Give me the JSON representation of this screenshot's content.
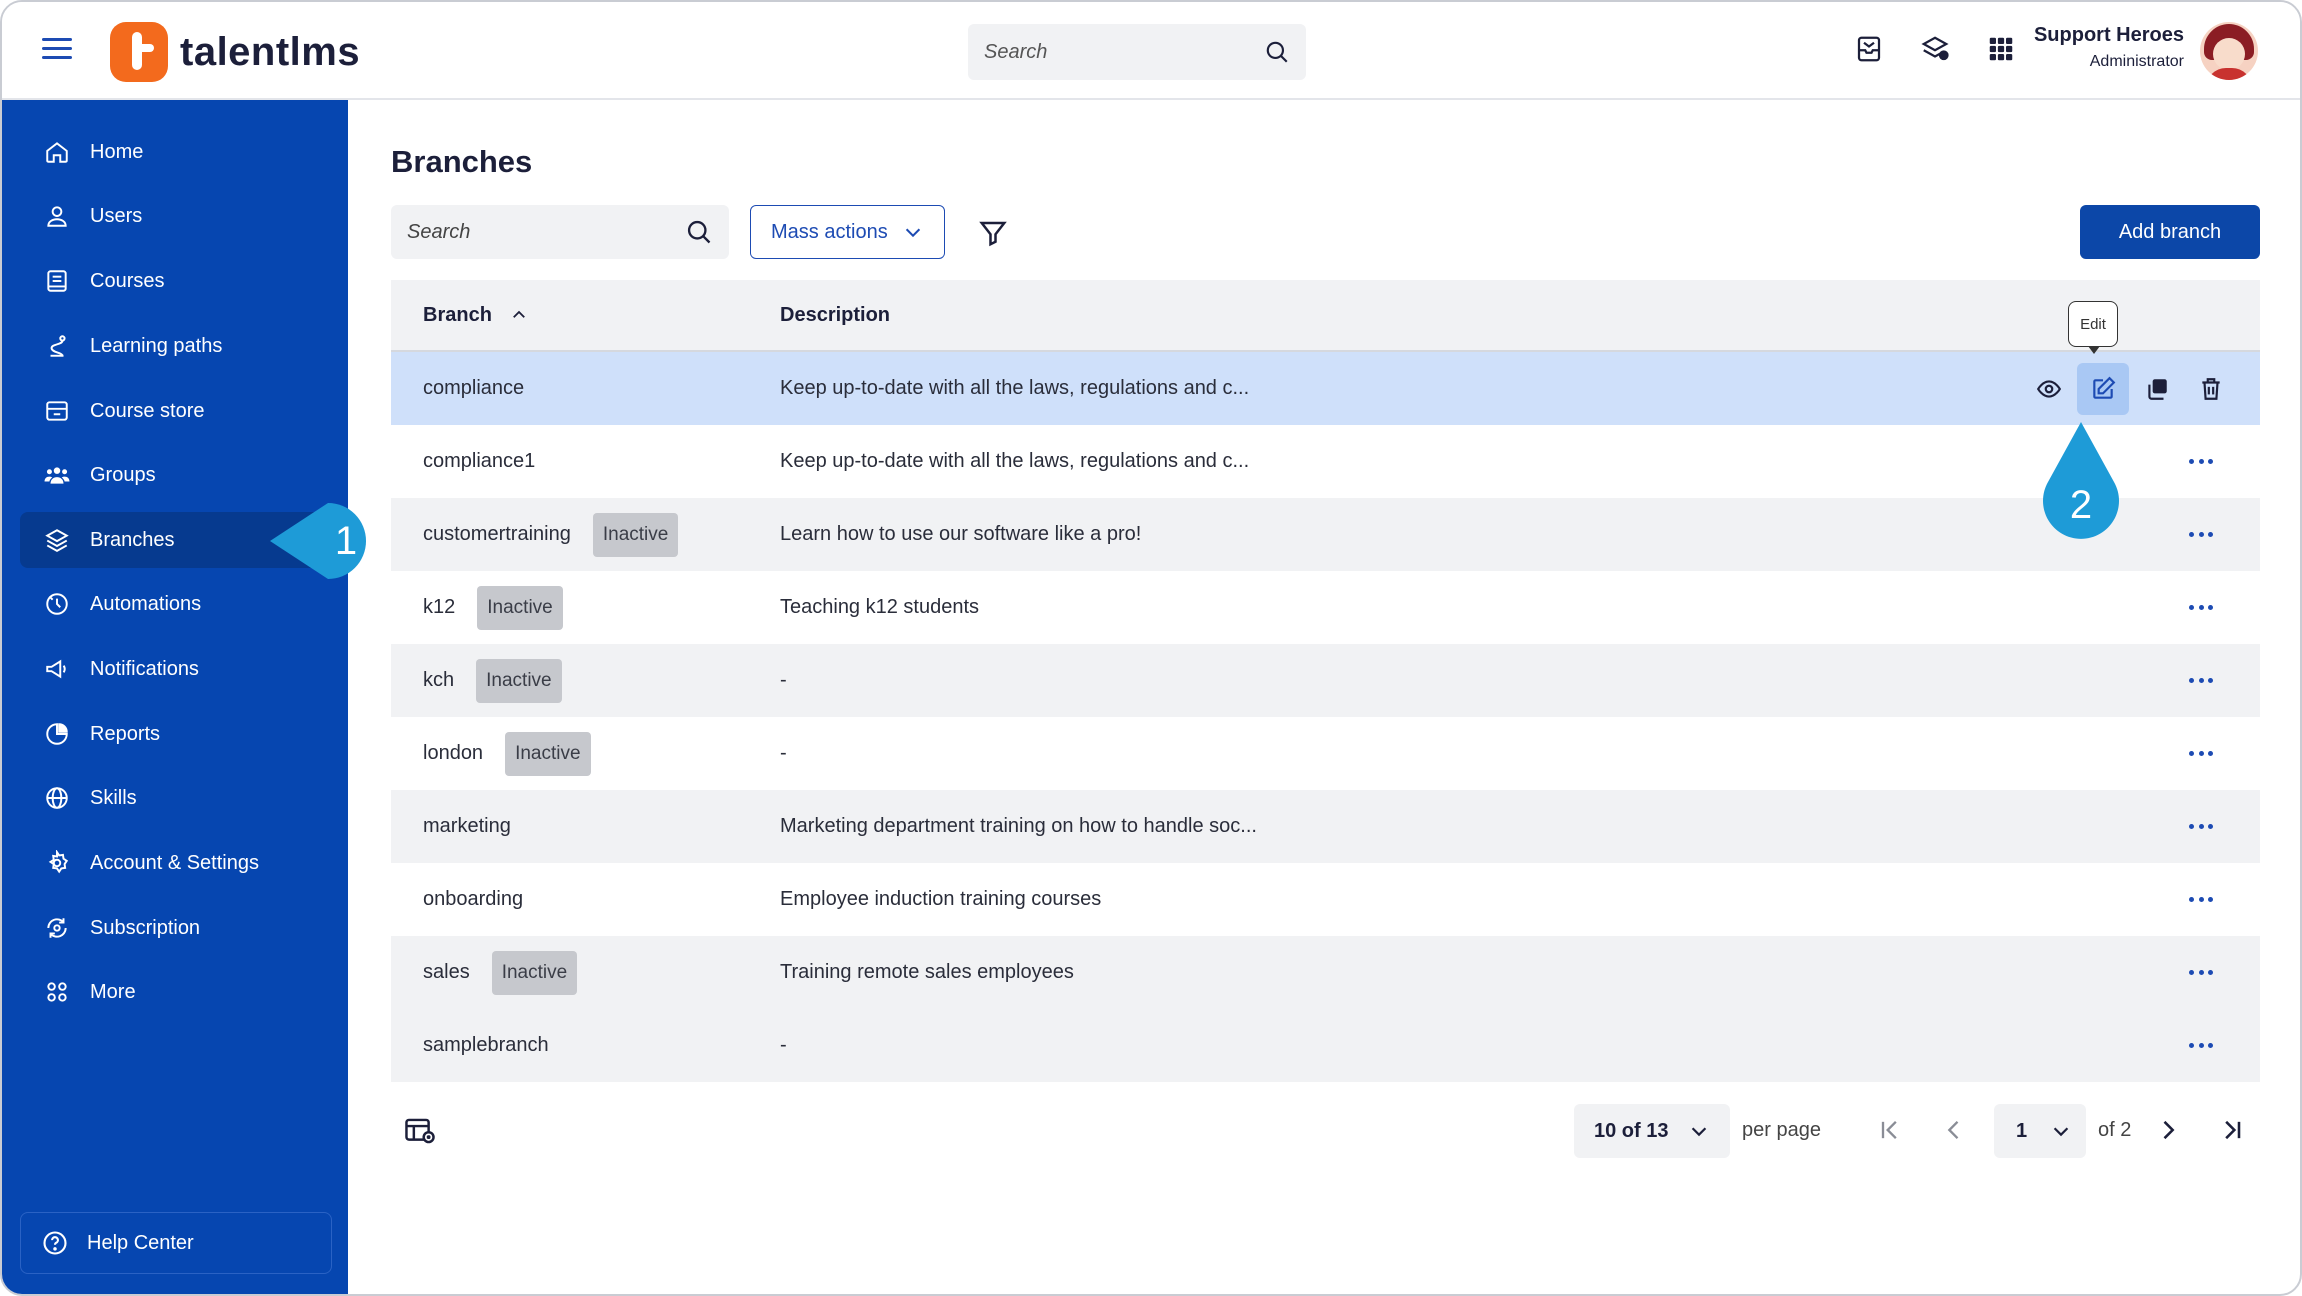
{
  "header": {
    "app_name": "talentlms",
    "search_placeholder": "Search",
    "user_name": "Support Heroes",
    "user_role": "Administrator"
  },
  "sidebar": {
    "items": [
      {
        "label": "Home",
        "icon": "home-icon"
      },
      {
        "label": "Users",
        "icon": "user-icon"
      },
      {
        "label": "Courses",
        "icon": "book-icon"
      },
      {
        "label": "Learning paths",
        "icon": "path-icon"
      },
      {
        "label": "Course store",
        "icon": "store-icon"
      },
      {
        "label": "Groups",
        "icon": "groups-icon"
      },
      {
        "label": "Branches",
        "icon": "layers-icon",
        "active": true
      },
      {
        "label": "Automations",
        "icon": "automation-icon"
      },
      {
        "label": "Notifications",
        "icon": "megaphone-icon"
      },
      {
        "label": "Reports",
        "icon": "pie-chart-icon"
      },
      {
        "label": "Skills",
        "icon": "globe-icon"
      },
      {
        "label": "Account & Settings",
        "icon": "gear-icon"
      },
      {
        "label": "Subscription",
        "icon": "subscription-icon"
      },
      {
        "label": "More",
        "icon": "grid-icon"
      }
    ],
    "help_center": "Help Center"
  },
  "main": {
    "title": "Branches",
    "search_placeholder": "Search",
    "mass_actions": "Mass actions",
    "add_branch": "Add branch",
    "columns": {
      "branch": "Branch",
      "description": "Description"
    },
    "tooltip": "Edit",
    "rows": [
      {
        "name": "compliance",
        "status": "",
        "description": "Keep up-to-date with all the laws, regulations and c..."
      },
      {
        "name": "compliance1",
        "status": "",
        "description": "Keep up-to-date with all the laws, regulations and c..."
      },
      {
        "name": "customertraining",
        "status": "Inactive",
        "description": "Learn how to use our software like a pro!"
      },
      {
        "name": "k12",
        "status": "Inactive",
        "description": "Teaching k12 students"
      },
      {
        "name": "kch",
        "status": "Inactive",
        "description": "-"
      },
      {
        "name": "london",
        "status": "Inactive",
        "description": "-"
      },
      {
        "name": "marketing",
        "status": "",
        "description": "Marketing department training on how to handle soc..."
      },
      {
        "name": "onboarding",
        "status": "",
        "description": "Employee induction training courses"
      },
      {
        "name": "sales",
        "status": "Inactive",
        "description": "Training remote sales employees"
      },
      {
        "name": "samplebranch",
        "status": "",
        "description": "-"
      }
    ]
  },
  "pagination": {
    "count": "10 of 13",
    "per_page_label": "per page",
    "current_page": "1",
    "of_pages": "of 2"
  },
  "callouts": {
    "first": "1",
    "second": "2"
  },
  "colors": {
    "sidebar_bg": "#0646b0",
    "accent": "#1d4bb3",
    "callout": "#1e9bd7",
    "logo": "#f36a1d",
    "selected_row": "#cfe0fa"
  }
}
